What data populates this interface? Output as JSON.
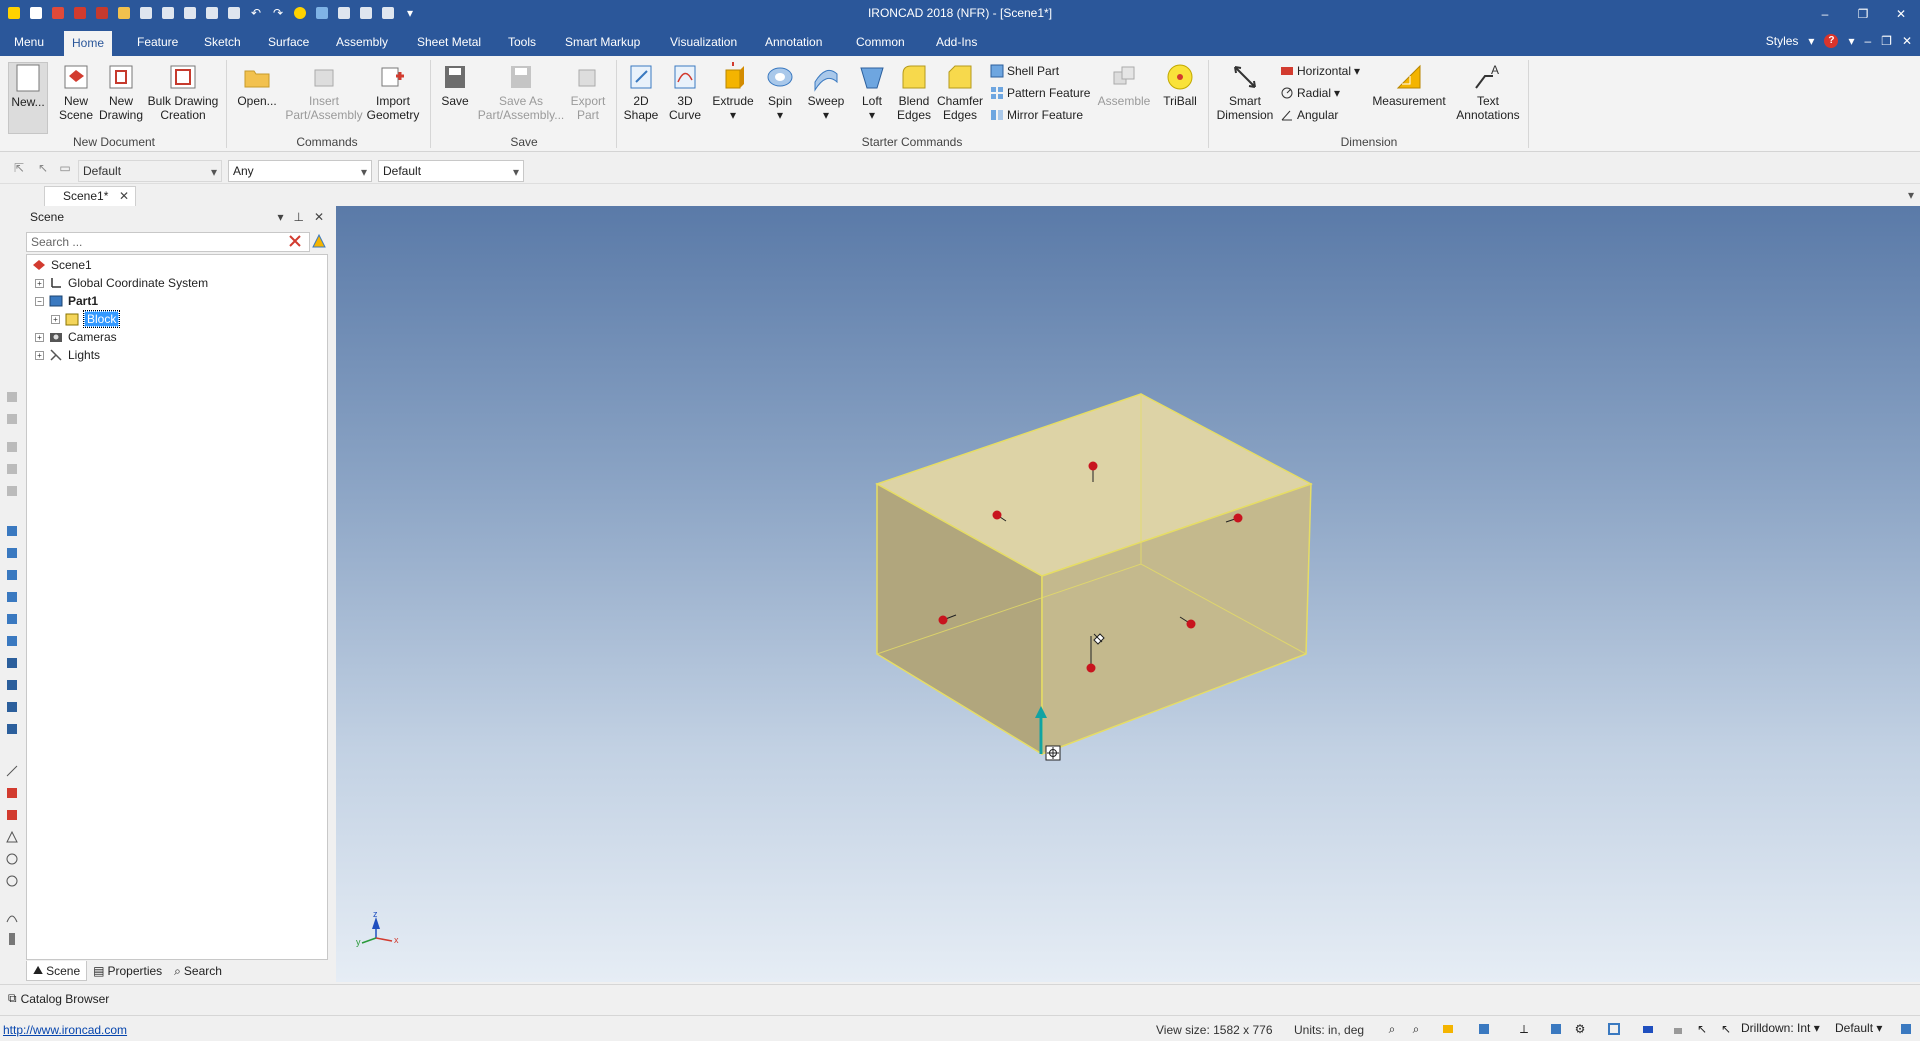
{
  "window": {
    "title": "IRONCAD 2018 (NFR) - [Scene1*]",
    "buttons": [
      "–",
      "❐",
      "✕"
    ]
  },
  "ribbon_tabs": [
    {
      "label": "Menu"
    },
    {
      "label": "Home",
      "active": true
    },
    {
      "label": "Feature"
    },
    {
      "label": "Sketch"
    },
    {
      "label": "Surface"
    },
    {
      "label": "Assembly"
    },
    {
      "label": "Sheet Metal"
    },
    {
      "label": "Tools"
    },
    {
      "label": "Smart Markup"
    },
    {
      "label": "Visualization"
    },
    {
      "label": "Annotation"
    },
    {
      "label": "Common"
    },
    {
      "label": "Add-Ins"
    }
  ],
  "styles_label": "Styles",
  "ribbon": {
    "new_document": {
      "group_label": "New Document",
      "new": "New...",
      "new_scene_1": "New",
      "new_scene_2": "Scene",
      "new_drawing_1": "New",
      "new_drawing_2": "Drawing",
      "bulk_1": "Bulk Drawing",
      "bulk_2": "Creation"
    },
    "commands": {
      "group_label": "Commands",
      "open": "Open...",
      "insert_1": "Insert",
      "insert_2": "Part/Assembly",
      "import_1": "Import",
      "import_2": "Geometry"
    },
    "save": {
      "group_label": "Save",
      "save": "Save",
      "save_as_1": "Save As",
      "save_as_2": "Part/Assembly...",
      "export_1": "Export",
      "export_2": "Part"
    },
    "starter": {
      "group_label": "Starter Commands",
      "shape2d_1": "2D",
      "shape2d_2": "Shape",
      "curve3d_1": "3D",
      "curve3d_2": "Curve",
      "extrude": "Extrude",
      "spin": "Spin",
      "sweep": "Sweep",
      "loft": "Loft",
      "blend_1": "Blend",
      "blend_2": "Edges",
      "chamfer_1": "Chamfer",
      "chamfer_2": "Edges",
      "shell": "Shell Part",
      "pattern": "Pattern Feature",
      "mirror": "Mirror Feature",
      "assemble": "Assemble",
      "triball": "TriBall"
    },
    "dimension": {
      "group_label": "Dimension",
      "smart_1": "Smart",
      "smart_2": "Dimension",
      "horizontal": "Horizontal",
      "radial": "Radial",
      "angular": "Angular",
      "measurement": "Measurement",
      "text_1": "Text",
      "text_2": "Annotations"
    }
  },
  "toolbar2": {
    "combo1": "Default",
    "combo2": "Any",
    "combo3": "Default"
  },
  "doc_tab": "Scene1*",
  "scene_panel": {
    "title": "Scene",
    "search_placeholder": "Search ...",
    "tree": [
      {
        "label": "Scene1"
      },
      {
        "label": "Global Coordinate System"
      },
      {
        "label": "Part1"
      },
      {
        "label": "Block"
      },
      {
        "label": "Cameras"
      },
      {
        "label": "Lights"
      }
    ],
    "bottom_tabs": [
      "Scene",
      "Properties",
      "Search"
    ]
  },
  "viewport": {
    "axis_labels": [
      "z",
      "y",
      "x"
    ]
  },
  "catalog_label": "Catalog Browser",
  "status": {
    "link": "http://www.ironcad.com",
    "view_size": "View size: 1582 x  776",
    "units": "Units: in, deg",
    "drilldown": "Drilldown: Int",
    "default_combo": "Default"
  },
  "colors": {
    "title_bar": "#2b579a",
    "block_face": "#c9bd8e",
    "block_edge": "#e8e070",
    "handle": "#c8141e",
    "anchor_arrow": "#11a3a3"
  }
}
